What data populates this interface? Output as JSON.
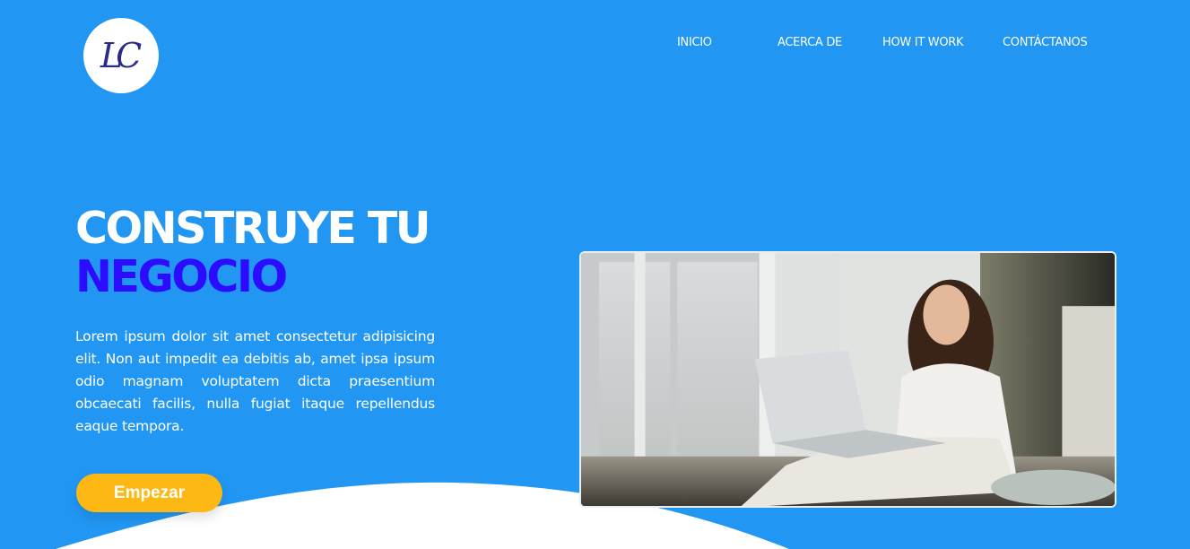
{
  "brand": {
    "logo_text": "LC"
  },
  "nav": {
    "items": [
      "INICIO",
      "ACERCA DE",
      "HOW IT WORK",
      "CONTÁCTANOS"
    ]
  },
  "hero": {
    "title_line1": "CONSTRUYE TU",
    "title_line2": "NEGOCIO",
    "paragraph": "Lorem ipsum dolor sit amet consectetur adipisicing elit. Non aut impedit ea debitis ab, amet ipsa ipsum odio magnam voluptatem dicta praesentium obcaecati facilis, nulla fugiat itaque repellendus eaque tempora.",
    "cta_label": "Empezar"
  },
  "colors": {
    "background": "#2196f3",
    "title_accent": "#2d0bff",
    "button": "#fdb813",
    "wave": "#ffffff"
  }
}
